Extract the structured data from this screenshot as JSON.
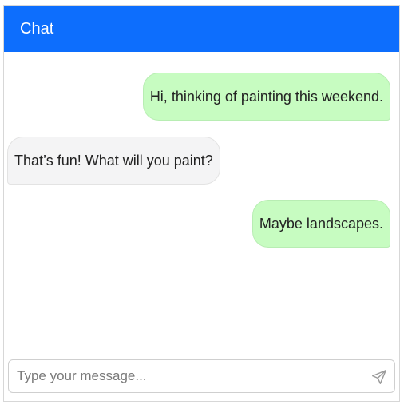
{
  "header": {
    "title": "Chat"
  },
  "messages": [
    {
      "sender": "user",
      "text": "Hi, thinking of painting this weekend."
    },
    {
      "sender": "other",
      "text": "That’s fun! What will you paint?"
    },
    {
      "sender": "user",
      "text": "Maybe landscapes."
    }
  ],
  "composer": {
    "placeholder": "Type your message...",
    "value": "",
    "send_icon": "send-icon"
  },
  "colors": {
    "header": "#0d6efd",
    "sent_bubble": "#c7fcc1",
    "received_bubble": "#f4f4f5"
  }
}
